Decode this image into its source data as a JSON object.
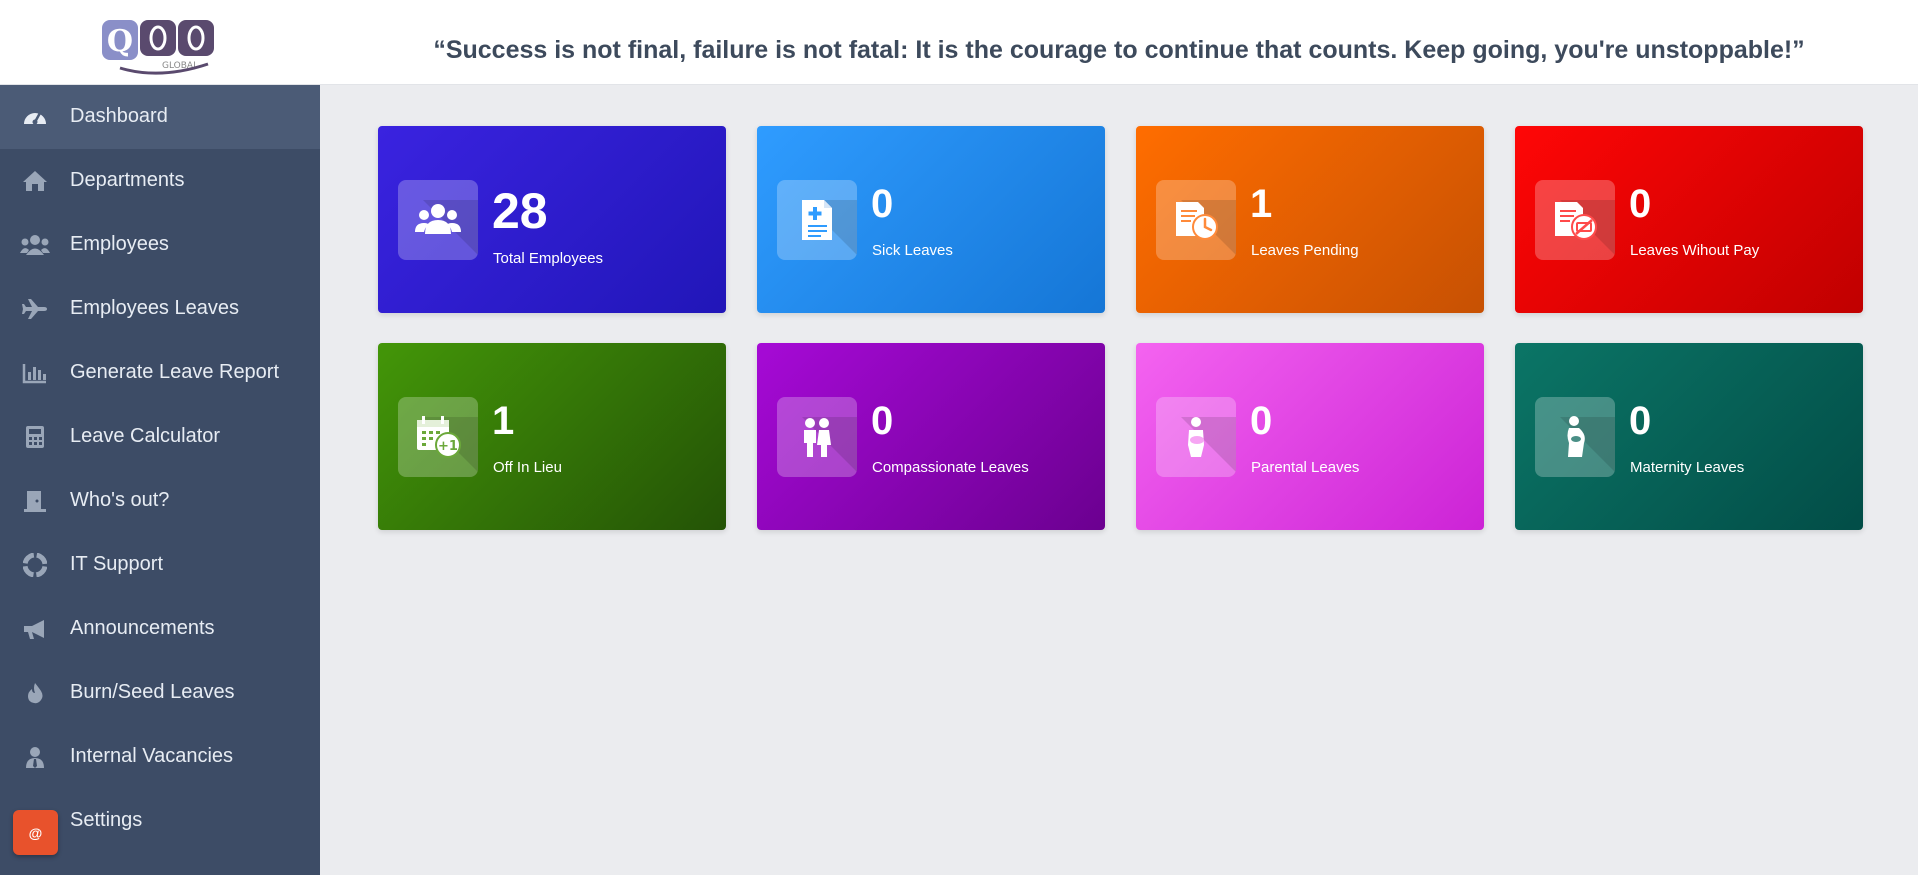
{
  "header": {
    "quote": "“Success is not final, failure is not fatal: It is the courage to continue that counts. Keep going, you're unstoppable!”"
  },
  "sidebar": {
    "items": [
      {
        "label": "Dashboard",
        "icon": "gauge-icon",
        "active": true
      },
      {
        "label": "Departments",
        "icon": "home-icon"
      },
      {
        "label": "Employees",
        "icon": "users-icon"
      },
      {
        "label": "Employees Leaves",
        "icon": "plane-icon"
      },
      {
        "label": "Generate Leave Report",
        "icon": "bar-chart-icon"
      },
      {
        "label": "Leave Calculator",
        "icon": "calculator-icon"
      },
      {
        "label": "Who's out?",
        "icon": "door-icon"
      },
      {
        "label": "IT Support",
        "icon": "lifebuoy-icon"
      },
      {
        "label": "Announcements",
        "icon": "megaphone-icon"
      },
      {
        "label": "Burn/Seed Leaves",
        "icon": "fire-icon"
      },
      {
        "label": "Internal Vacancies",
        "icon": "user-tie-icon"
      },
      {
        "label": "Settings",
        "icon": "briefcase-icon"
      }
    ],
    "chat_button": "@"
  },
  "cards": [
    {
      "value": "28",
      "label": "Total Employees",
      "icon": "users-group-icon",
      "color": "#3a23e0"
    },
    {
      "value": "0",
      "label": "Sick Leaves",
      "icon": "medical-document-icon",
      "color": "#2f9cff"
    },
    {
      "value": "1",
      "label": "Leaves Pending",
      "icon": "document-clock-icon",
      "color": "#ff6d00"
    },
    {
      "value": "0",
      "label": "Leaves Wihout Pay",
      "icon": "document-no-money-icon",
      "color": "#ff0606"
    },
    {
      "value": "1",
      "label": "Off In Lieu",
      "icon": "calendar-plus-one-icon",
      "color": "#439608"
    },
    {
      "value": "0",
      "label": "Compassionate Leaves",
      "icon": "couple-icon",
      "color": "#a60ad6"
    },
    {
      "value": "0",
      "label": "Parental Leaves",
      "icon": "parent-baby-icon",
      "color": "#f463f0"
    },
    {
      "value": "0",
      "label": "Maternity Leaves",
      "icon": "pregnant-icon",
      "color": "#0b7566"
    }
  ]
}
